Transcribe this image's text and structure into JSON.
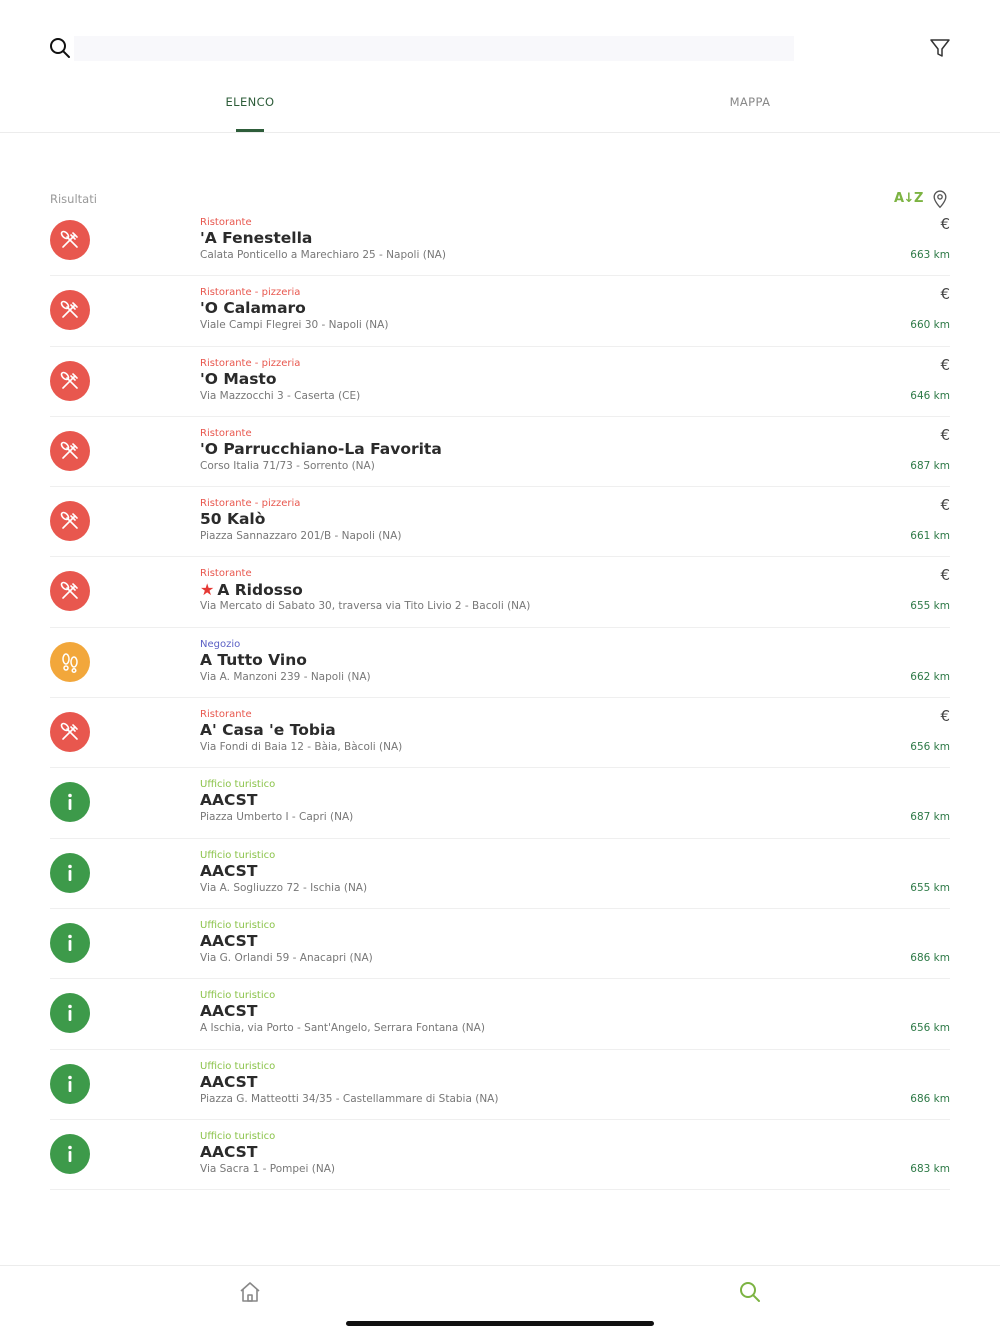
{
  "search": {
    "placeholder": ""
  },
  "tabs": [
    {
      "label": "ELENCO",
      "active": true
    },
    {
      "label": "MAPPA",
      "active": false
    }
  ],
  "results": {
    "label": "Risultati",
    "sort_label": "A↓Z"
  },
  "colors": {
    "restaurant": "#e8574e",
    "shop": "#f2a73b",
    "tourist": "#3d9a4a",
    "cat_restaurant": "#e8574e",
    "cat_shop": "#5a5fc4",
    "cat_tourist": "#8bc34a",
    "accent": "#2e5d3a"
  },
  "items": [
    {
      "type": "restaurant",
      "icon": "fork-knife-icon",
      "category": "Ristorante",
      "name": "'A Fenestella",
      "address": "Calata Ponticello a Marechiaro 25 - Napoli (NA)",
      "price": "€",
      "distance": "663 km",
      "starred": false
    },
    {
      "type": "restaurant",
      "icon": "fork-knife-icon",
      "category": "Ristorante - pizzeria",
      "name": "'O Calamaro",
      "address": "Viale Campi Flegrei 30 - Napoli (NA)",
      "price": "€",
      "distance": "660 km",
      "starred": false
    },
    {
      "type": "restaurant",
      "icon": "fork-knife-icon",
      "category": "Ristorante - pizzeria",
      "name": "'O Masto",
      "address": "Via Mazzocchi 3 - Caserta (CE)",
      "price": "€",
      "distance": "646 km",
      "starred": false
    },
    {
      "type": "restaurant",
      "icon": "fork-knife-icon",
      "category": "Ristorante",
      "name": "'O Parrucchiano-La Favorita",
      "address": "Corso Italia 71/73 - Sorrento (NA)",
      "price": "€",
      "distance": "687 km",
      "starred": false
    },
    {
      "type": "restaurant",
      "icon": "fork-knife-icon",
      "category": "Ristorante - pizzeria",
      "name": "50 Kalò",
      "address": "Piazza Sannazzaro 201/B - Napoli (NA)",
      "price": "€",
      "distance": "661 km",
      "starred": false
    },
    {
      "type": "restaurant",
      "icon": "fork-knife-icon",
      "category": "Ristorante",
      "name": "A Ridosso",
      "address": "Via Mercato di Sabato 30, traversa via Tito Livio 2 - Bacoli (NA)",
      "price": "€",
      "distance": "655 km",
      "starred": true
    },
    {
      "type": "shop",
      "icon": "footprints-icon",
      "category": "Negozio",
      "name": "A Tutto Vino",
      "address": "Via A. Manzoni 239 - Napoli (NA)",
      "price": "",
      "distance": "662 km",
      "starred": false
    },
    {
      "type": "restaurant",
      "icon": "fork-knife-icon",
      "category": "Ristorante",
      "name": "A' Casa 'e Tobia",
      "address": "Via Fondi di Baia 12 - Bàia, Bàcoli (NA)",
      "price": "€",
      "distance": "656 km",
      "starred": false
    },
    {
      "type": "tourist",
      "icon": "info-icon",
      "category": "Ufficio turistico",
      "name": "AACST",
      "address": "Piazza Umberto I - Capri (NA)",
      "price": "",
      "distance": "687 km",
      "starred": false
    },
    {
      "type": "tourist",
      "icon": "info-icon",
      "category": "Ufficio turistico",
      "name": "AACST",
      "address": "Via A. Sogliuzzo 72 - Ischia (NA)",
      "price": "",
      "distance": "655 km",
      "starred": false
    },
    {
      "type": "tourist",
      "icon": "info-icon",
      "category": "Ufficio turistico",
      "name": "AACST",
      "address": "Via G. Orlandi 59 - Anacapri (NA)",
      "price": "",
      "distance": "686 km",
      "starred": false
    },
    {
      "type": "tourist",
      "icon": "info-icon",
      "category": "Ufficio turistico",
      "name": "AACST",
      "address": "A Ischia, via Porto - Sant'Angelo, Serrara Fontana (NA)",
      "price": "",
      "distance": "656 km",
      "starred": false
    },
    {
      "type": "tourist",
      "icon": "info-icon",
      "category": "Ufficio turistico",
      "name": "AACST",
      "address": "Piazza G. Matteotti 34/35 - Castellammare di Stabia (NA)",
      "price": "",
      "distance": "686 km",
      "starred": false
    },
    {
      "type": "tourist",
      "icon": "info-icon",
      "category": "Ufficio turistico",
      "name": "AACST",
      "address": "Via Sacra 1 - Pompei (NA)",
      "price": "",
      "distance": "683 km",
      "starred": false
    }
  ],
  "bottom_nav": [
    {
      "icon": "home-icon",
      "active": false
    },
    {
      "icon": "search-icon",
      "active": true
    }
  ]
}
